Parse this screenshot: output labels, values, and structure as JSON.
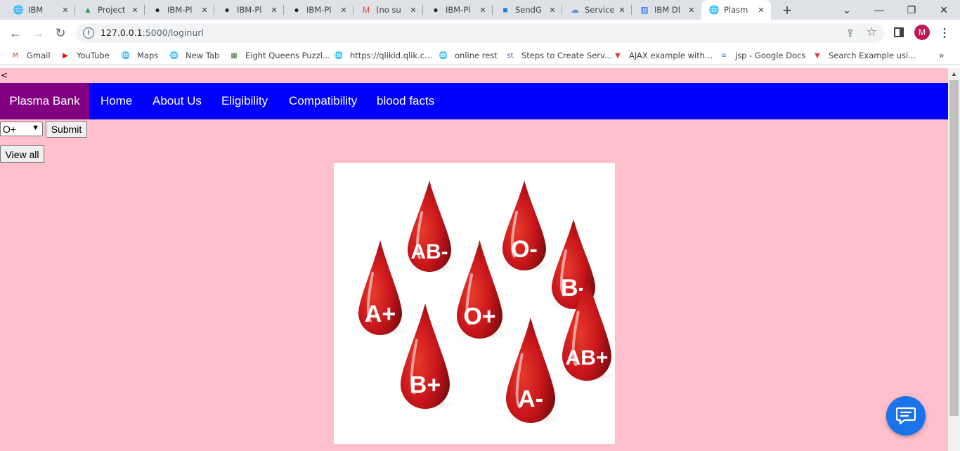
{
  "browser": {
    "tabs": [
      {
        "title": "IBM",
        "icon": "globe-icon",
        "color": "#5f6368"
      },
      {
        "title": "Project",
        "icon": "google-drive-icon",
        "color": "#1fa463"
      },
      {
        "title": "IBM-Pl",
        "icon": "github-icon",
        "color": "#24292f"
      },
      {
        "title": "IBM-Pl",
        "icon": "github-icon",
        "color": "#24292f"
      },
      {
        "title": "IBM-Pl",
        "icon": "github-icon",
        "color": "#24292f"
      },
      {
        "title": "(no su",
        "icon": "gmail-icon",
        "color": "#ea4335"
      },
      {
        "title": "IBM-Pl",
        "icon": "github-icon",
        "color": "#24292f"
      },
      {
        "title": "SendG",
        "icon": "sendgrid-icon",
        "color": "#1a82e2"
      },
      {
        "title": "Service",
        "icon": "cloud-icon",
        "color": "#4a90d9"
      },
      {
        "title": "IBM Dl",
        "icon": "ibm-db-icon",
        "color": "#0f62fe"
      },
      {
        "title": "Plasm",
        "icon": "globe-icon",
        "color": "#5f6368"
      }
    ],
    "active_tab_index": 10,
    "address": {
      "host": "127.0.0.1",
      "path": ":5000/loginurl"
    },
    "profile_initial": "M",
    "profile_color": "#c2185b",
    "bookmarks": [
      {
        "label": "Gmail",
        "icon": "gmail-icon"
      },
      {
        "label": "YouTube",
        "icon": "youtube-icon"
      },
      {
        "label": "Maps",
        "icon": "globe-icon"
      },
      {
        "label": "New Tab",
        "icon": "globe-icon"
      },
      {
        "label": "Eight Queens Puzzl...",
        "icon": "image-icon"
      },
      {
        "label": "https://qlikid.qlik.c...",
        "icon": "globe-icon"
      },
      {
        "label": "online rest",
        "icon": "globe-icon"
      },
      {
        "label": "Steps to Create Serv...",
        "icon": "st-icon"
      },
      {
        "label": "AJAX example with...",
        "icon": "t-icon"
      },
      {
        "label": "jsp - Google Docs",
        "icon": "docs-icon"
      },
      {
        "label": "Search Example usi...",
        "icon": "t-icon"
      }
    ],
    "bookmarks_more": "»"
  },
  "page": {
    "back_marker": "<",
    "brand": "Plasma Bank",
    "nav": [
      "Home",
      "About Us",
      "Eligibility",
      "Compatibility",
      "blood facts"
    ],
    "blood_select": {
      "value": "O+",
      "options": [
        "O+"
      ]
    },
    "submit_label": "Submit",
    "view_all_label": "View all",
    "hero_image": {
      "drops": [
        "AB-",
        "O-",
        "B-",
        "A+",
        "O+",
        "AB+",
        "B+",
        "A-"
      ]
    },
    "colors": {
      "background": "#ffc0cb",
      "navbar": "#0000ff",
      "brand": "#800080",
      "fab": "#1a73e8"
    }
  }
}
